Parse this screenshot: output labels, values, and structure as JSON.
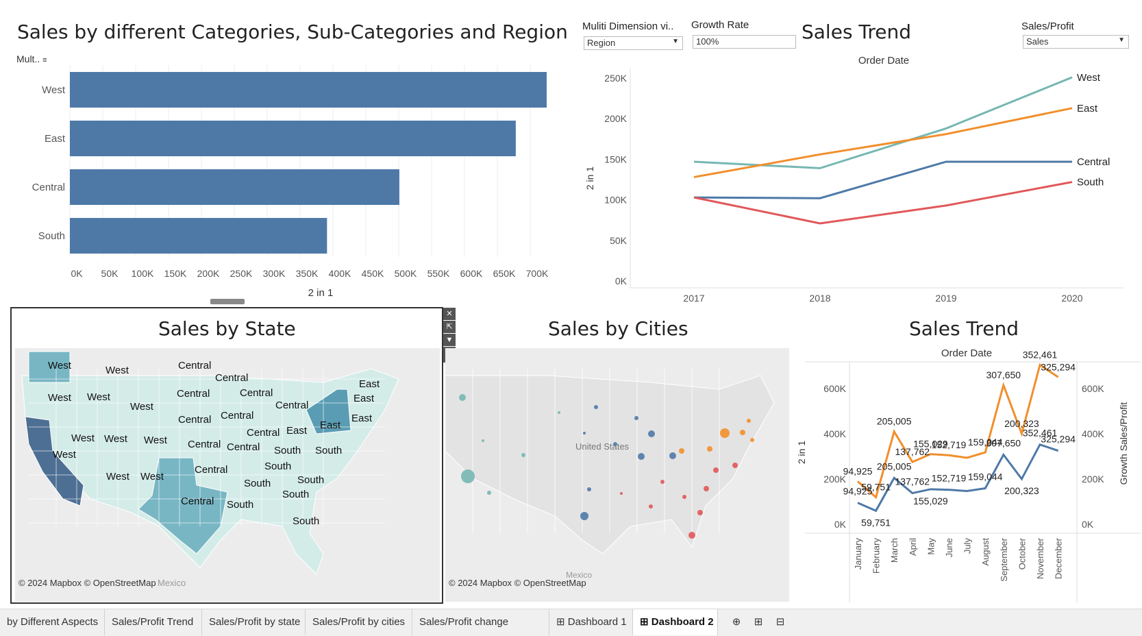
{
  "left_edge_strip": true,
  "dashboard": {
    "title_main": "Sales by different Categories, Sub-Categories and Region",
    "mult_label": "Mult..",
    "filter_multi_label": "Muliti Dimension vi..",
    "filter_multi_value": "Region",
    "growth_rate_label": "Growth Rate",
    "growth_rate_value": "100%",
    "trend_title": "Sales Trend",
    "sales_profit_label": "Sales/Profit",
    "sales_profit_value": "Sales",
    "state_title": "Sales by State",
    "cities_title": "Sales by Cities",
    "trend2_title": "Sales Trend",
    "map_credit": "© 2024 Mapbox © OpenStreetMap",
    "mexico_label": "Mexico",
    "united_states_label": "United States"
  },
  "chart_data": [
    {
      "type": "bar",
      "orientation": "horizontal",
      "categories": [
        "West",
        "East",
        "Central",
        "South"
      ],
      "values": [
        725000,
        678000,
        501000,
        391000
      ],
      "xlabel": "2 in 1",
      "xlim": [
        0,
        750000
      ],
      "xticks": [
        "0K",
        "50K",
        "100K",
        "150K",
        "200K",
        "250K",
        "300K",
        "350K",
        "400K",
        "450K",
        "500K",
        "550K",
        "600K",
        "650K",
        "700K"
      ],
      "color": "#4e79a7"
    },
    {
      "type": "line",
      "title": "Order Date",
      "ylabel": "2 in 1",
      "x": [
        "2017",
        "2018",
        "2019",
        "2020"
      ],
      "yticks": [
        "0K",
        "50K",
        "100K",
        "150K",
        "200K",
        "250K"
      ],
      "ylim": [
        0,
        250000
      ],
      "series": [
        {
          "name": "West",
          "values": [
            147000,
            139000,
            188000,
            251000
          ],
          "color": "#76b7b2"
        },
        {
          "name": "East",
          "values": [
            128000,
            156000,
            181000,
            213000
          ],
          "color": "#f28e2b"
        },
        {
          "name": "Central",
          "values": [
            103000,
            102000,
            147000,
            147000
          ],
          "color": "#4e79a7"
        },
        {
          "name": "South",
          "values": [
            103000,
            71000,
            93000,
            122000
          ],
          "color": "#e15759"
        }
      ]
    },
    {
      "type": "line",
      "title": "Order Date",
      "ylabel": "2 in 1",
      "ylabel_right": "Growth Sales/Profit",
      "x": [
        "January",
        "February",
        "March",
        "April",
        "May",
        "June",
        "July",
        "August",
        "September",
        "October",
        "November",
        "December"
      ],
      "yticks": [
        "0K",
        "200K",
        "400K",
        "600K"
      ],
      "ylim": [
        0,
        700000
      ],
      "series": [
        {
          "name": "Sales",
          "values": [
            94925,
            59751,
            205005,
            137762,
            155029,
            152719,
            147000,
            159044,
            307650,
            200323,
            352461,
            325294
          ],
          "color": "#4e79a7"
        },
        {
          "name": "Growth",
          "values": [
            189850,
            119502,
            410010,
            275524,
            310058,
            305438,
            294000,
            318088,
            615300,
            400646,
            704922,
            650588
          ],
          "color": "#f28e2b"
        }
      ],
      "data_labels": [
        "94,925",
        "59,751",
        "205,005",
        "137,762",
        "155,029",
        "152,719",
        "159,044",
        "307,650",
        "200,323",
        "352,461",
        "325,294"
      ]
    }
  ],
  "state_map": {
    "regions": [
      "West",
      "Central",
      "East",
      "South"
    ],
    "colors": {
      "West_light": "#c9e6e2",
      "West_dark": "#4e6f94",
      "Central_mid": "#78b6c4",
      "East_dark": "#5a9cb3",
      "light": "#d4ece8"
    }
  },
  "tabs": [
    {
      "label": "by Different Aspects",
      "active": false
    },
    {
      "label": "Sales/Profit Trend",
      "active": false
    },
    {
      "label": "Sales/Profit by state",
      "active": false
    },
    {
      "label": "Sales/Profit by cities",
      "active": false
    },
    {
      "label": "Sales/Profit change",
      "active": false
    },
    {
      "label": "⊞ Dashboard 1",
      "active": false
    },
    {
      "label": "⊞ Dashboard 2",
      "active": true
    }
  ]
}
